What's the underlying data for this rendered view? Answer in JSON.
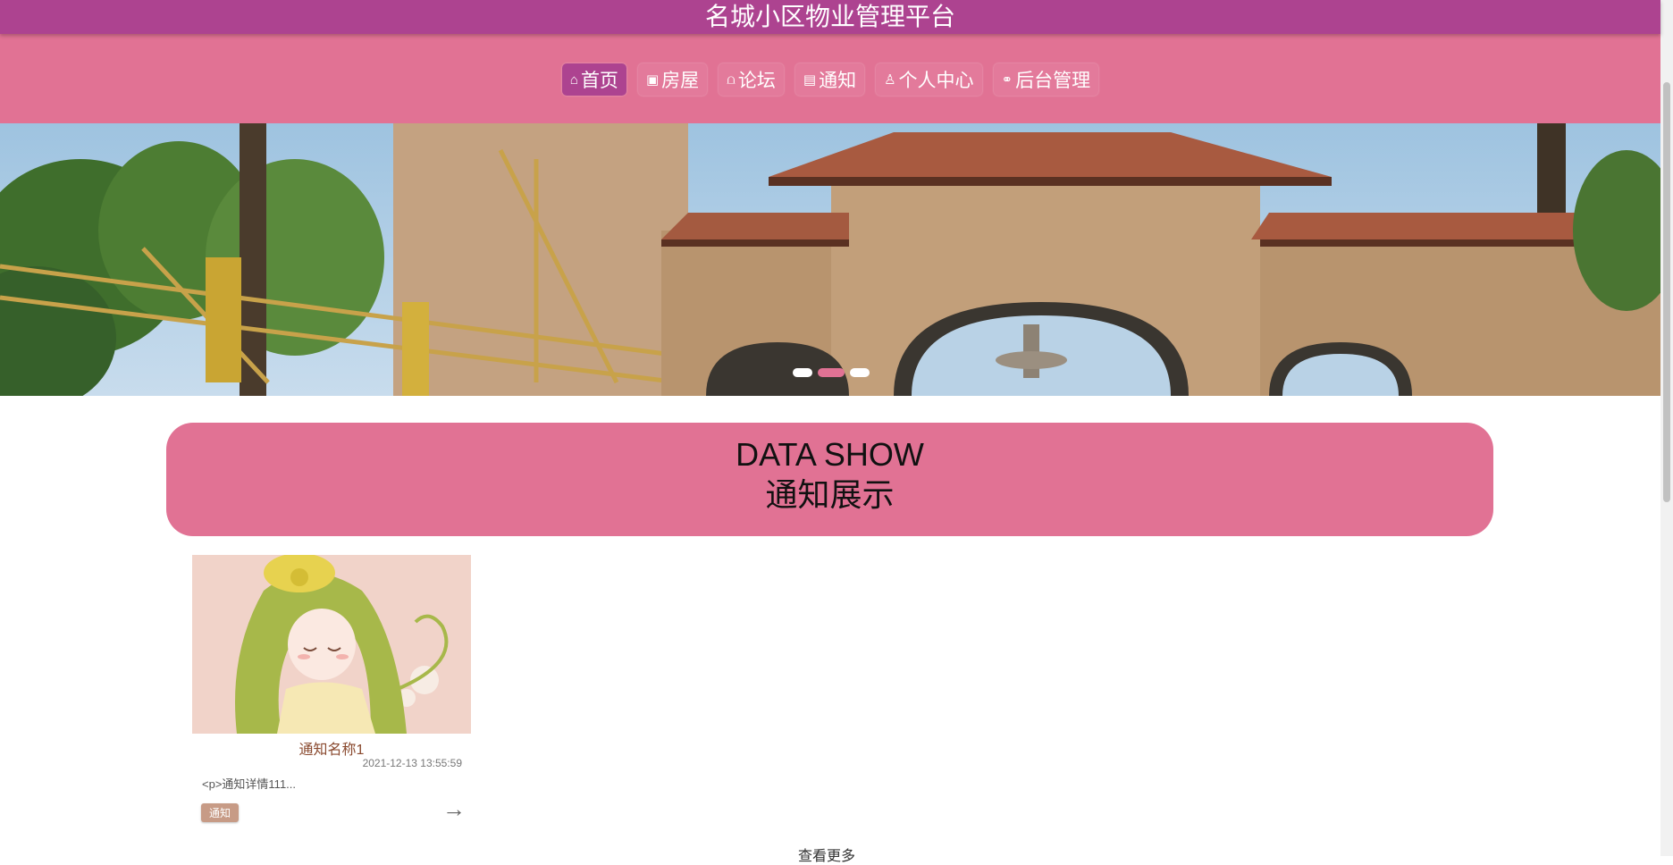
{
  "header": {
    "site_title": "名城小区物业管理平台",
    "brand_color": "#ad4390",
    "nav_color": "#e17294"
  },
  "nav": {
    "items": [
      {
        "label": "首页",
        "icon": "home-icon",
        "active": true
      },
      {
        "label": "房屋",
        "icon": "gift-icon",
        "active": false
      },
      {
        "label": "论坛",
        "icon": "book-icon",
        "active": false
      },
      {
        "label": "通知",
        "icon": "clipboard-icon",
        "active": false
      },
      {
        "label": "个人中心",
        "icon": "user-icon",
        "active": false
      },
      {
        "label": "后台管理",
        "icon": "link-icon",
        "active": false
      }
    ]
  },
  "carousel": {
    "slide_count": 3,
    "active_index": 1
  },
  "section": {
    "title_en": "DATA SHOW",
    "title_cn": "通知展示"
  },
  "cards": [
    {
      "title": "通知名称1",
      "time": "2021-12-13 13:55:59",
      "desc": "<p>通知详情111...",
      "tag": "通知",
      "arrow": "→"
    }
  ],
  "footer": {
    "more_label": "查看更多"
  }
}
